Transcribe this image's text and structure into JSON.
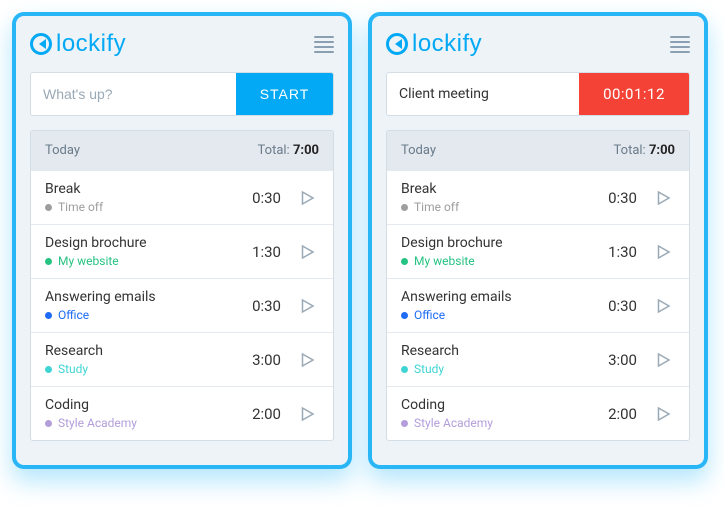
{
  "app": {
    "brand": "lockify"
  },
  "panels": [
    {
      "timer": {
        "placeholder": "What's up?",
        "value": "",
        "button": "START",
        "running": false
      },
      "day_label": "Today",
      "total_label": "Total:",
      "total_value": "7:00"
    },
    {
      "timer": {
        "placeholder": "",
        "value": "Client meeting",
        "button": "00:01:12",
        "running": true
      },
      "day_label": "Today",
      "total_label": "Total:",
      "total_value": "7:00"
    }
  ],
  "entries": [
    {
      "title": "Break",
      "project": "Time off",
      "color": "#9e9e9e",
      "duration": "0:30"
    },
    {
      "title": "Design brochure",
      "project": "My website",
      "color": "#26c281",
      "duration": "1:30"
    },
    {
      "title": "Answering emails",
      "project": "Office",
      "color": "#1e6bf5",
      "duration": "0:30"
    },
    {
      "title": "Research",
      "project": "Study",
      "color": "#3fd4d4",
      "duration": "3:00"
    },
    {
      "title": "Coding",
      "project": "Style Academy",
      "color": "#b39ddb",
      "duration": "2:00"
    }
  ]
}
